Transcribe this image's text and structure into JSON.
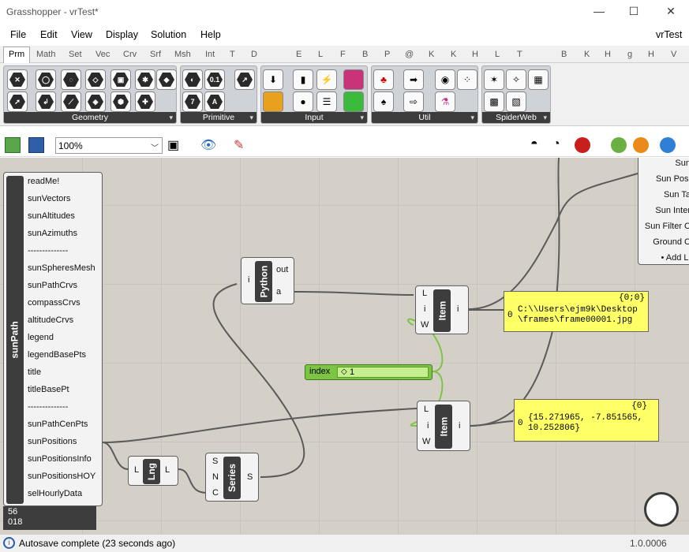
{
  "window": {
    "title": "Grasshopper - vrTest*",
    "min": "—",
    "max": "☐",
    "close": "✕"
  },
  "menu": {
    "items": [
      "File",
      "Edit",
      "View",
      "Display",
      "Solution",
      "Help"
    ],
    "doc_name": "vrTest"
  },
  "tabs": [
    "Prm",
    "Math",
    "Set",
    "Vec",
    "Crv",
    "Srf",
    "Msh",
    "Int",
    "T",
    "D",
    "E",
    "L",
    "F",
    "B",
    "P",
    "@",
    "K",
    "K",
    "H",
    "L",
    "T",
    "B",
    "K",
    "H",
    "g",
    "H",
    "V"
  ],
  "palette": {
    "groups": [
      "Geometry",
      "Primitive",
      "Input",
      "Util",
      "SpiderWeb"
    ],
    "primitive_icons": [
      "0.1",
      "7",
      "A"
    ]
  },
  "toolbar": {
    "zoom": "100%"
  },
  "components": {
    "sunpath": {
      "name": "sunPath",
      "outputs": [
        "readMe!",
        "sunVectors",
        "sunAltitudes",
        "sunAzimuths",
        "--------------",
        "sunSpheresMesh",
        "sunPathCrvs",
        "compassCrvs",
        "altitudeCrvs",
        "legend",
        "legendBasePts",
        "title",
        "titleBasePt",
        "--------------",
        "sunPathCenPts",
        "sunPositions",
        "sunPositionsInfo",
        "sunPositionsHOY",
        "selHourlyData"
      ],
      "bottom_a": "56",
      "bottom_b": "018"
    },
    "python": {
      "name": "Python",
      "in": "i",
      "out1": "out",
      "out2": "a"
    },
    "item1": {
      "name": "Item",
      "in1": "L",
      "in2": "i",
      "in3": "W",
      "out": "i"
    },
    "item2": {
      "name": "Item",
      "in1": "L",
      "in2": "i",
      "in3": "W",
      "out": "i"
    },
    "lng": {
      "name": "Lng",
      "in": "L",
      "out": "L"
    },
    "series": {
      "name": "Series",
      "in1": "S",
      "in2": "N",
      "in3": "C",
      "out": "S"
    },
    "slider": {
      "name": "index",
      "value": "1"
    },
    "panel1": {
      "path": "{0;0}",
      "index": "0",
      "text": "C:\\\\Users\\ejm9k\\Desktop\n\\frames\\frame00001.jpg"
    },
    "panel2": {
      "path": "{0}",
      "index": "0",
      "text": "{15.271965, -7.851565,\n10.252806}"
    },
    "right_comp": [
      "Sun",
      "Sun Posi",
      "Sun Ta",
      "Sun Inter",
      "Sun Filter C",
      "Ground C",
      "• Add Li"
    ]
  },
  "status": {
    "text": "Autosave complete (23 seconds ago)",
    "version": "1.0.0006"
  },
  "colors": {
    "canvas": "#d4d0c8",
    "panel": "#ffff66",
    "slider": "#7dc444",
    "component": "#3d3d3d"
  }
}
